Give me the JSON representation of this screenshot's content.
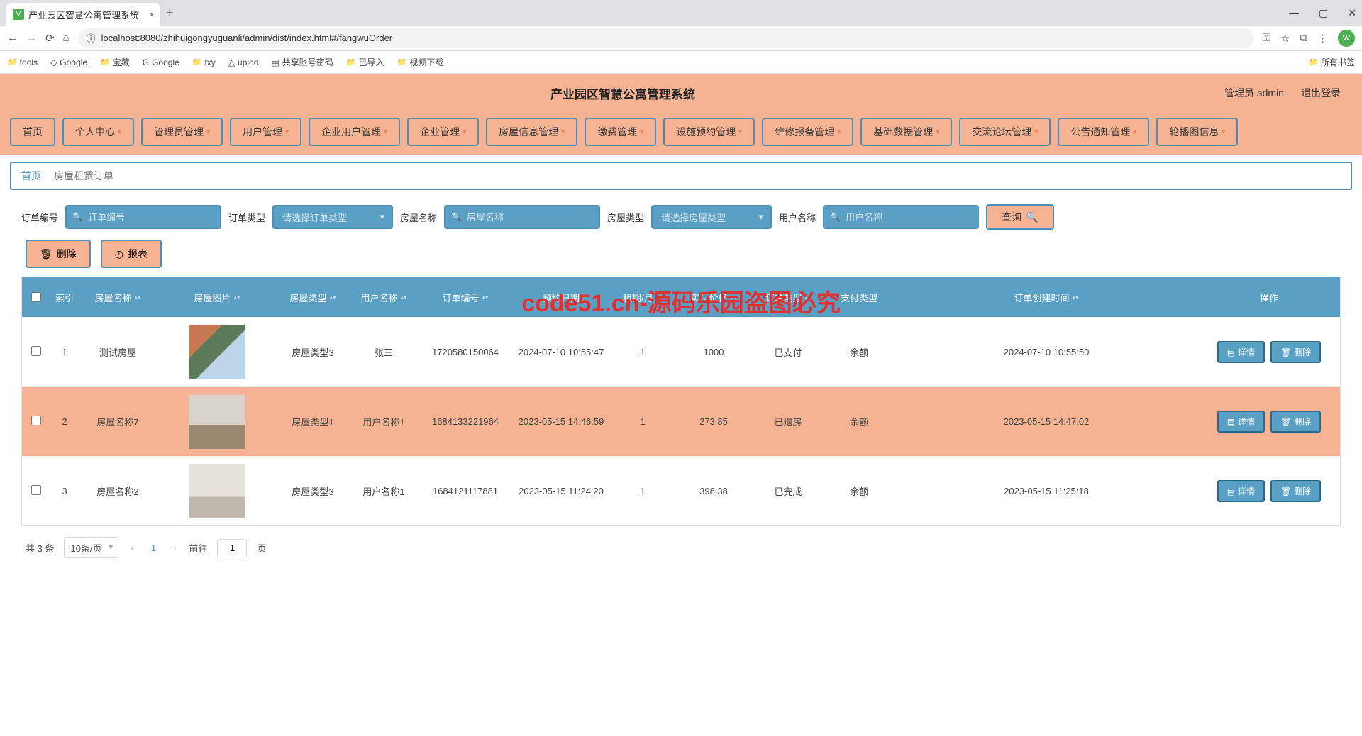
{
  "browser": {
    "tab_title": "产业园区智慧公寓管理系统",
    "url": "localhost:8080/zhihuigongyuguanli/admin/dist/index.html#/fangwuOrder",
    "bookmarks": [
      "tools",
      "Google",
      "宝藏",
      "Google",
      "txy",
      "uplod",
      "共享账号密码",
      "已导入",
      "视频下载"
    ],
    "all_bookmarks": "所有书签"
  },
  "app": {
    "title": "产业园区智慧公寓管理系统",
    "user_label": "管理员 admin",
    "logout": "退出登录"
  },
  "nav": [
    "首页",
    "个人中心",
    "管理员管理",
    "用户管理",
    "企业用户管理",
    "企业管理",
    "房屋信息管理",
    "缴费管理",
    "设施预约管理",
    "维修报备管理",
    "基础数据管理",
    "交流论坛管理",
    "公告通知管理",
    "轮播图信息"
  ],
  "breadcrumb": {
    "home": "首页",
    "current": "房屋租赁订单"
  },
  "filters": {
    "f1_label": "订单编号",
    "f1_ph": "订单编号",
    "f2_label": "订单类型",
    "f2_ph": "请选择订单类型",
    "f3_label": "房屋名称",
    "f3_ph": "房屋名称",
    "f4_label": "房屋类型",
    "f4_ph": "请选择房屋类型",
    "f5_label": "用户名称",
    "f5_ph": "用户名称",
    "search": "查询"
  },
  "actions": {
    "delete": "删除",
    "report": "报表"
  },
  "table": {
    "headers": [
      "",
      "索引",
      "房屋名称",
      "房屋图片",
      "房屋类型",
      "用户名称",
      "订单编号",
      "预约日期",
      "租期/月",
      "实付价格",
      "订单类型",
      "支付类型",
      "订单创建时间",
      "操作"
    ],
    "rows": [
      {
        "idx": "1",
        "name": "测试房屋",
        "type": "房屋类型3",
        "user": "张三",
        "num": "1720580150064",
        "date": "2024-07-10 10:55:47",
        "period": "1",
        "price": "1000",
        "otype": "已支付",
        "pay": "余额",
        "created": "2024-07-10 10:55:50"
      },
      {
        "idx": "2",
        "name": "房屋名称7",
        "type": "房屋类型1",
        "user": "用户名称1",
        "num": "1684133221964",
        "date": "2023-05-15 14:46:59",
        "period": "1",
        "price": "273.85",
        "otype": "已退房",
        "pay": "余额",
        "created": "2023-05-15 14:47:02"
      },
      {
        "idx": "3",
        "name": "房屋名称2",
        "type": "房屋类型3",
        "user": "用户名称1",
        "num": "1684121117881",
        "date": "2023-05-15 11:24:20",
        "period": "1",
        "price": "398.38",
        "otype": "已完成",
        "pay": "余额",
        "created": "2023-05-15 11:25:18"
      }
    ],
    "row_detail": "详情",
    "row_delete": "删除"
  },
  "pager": {
    "total": "共 3 条",
    "size": "10条/页",
    "current": "1",
    "goto": "前往",
    "goto_val": "1",
    "page_suffix": "页"
  },
  "watermark": "code51.cn-源码乐园盗图必究"
}
